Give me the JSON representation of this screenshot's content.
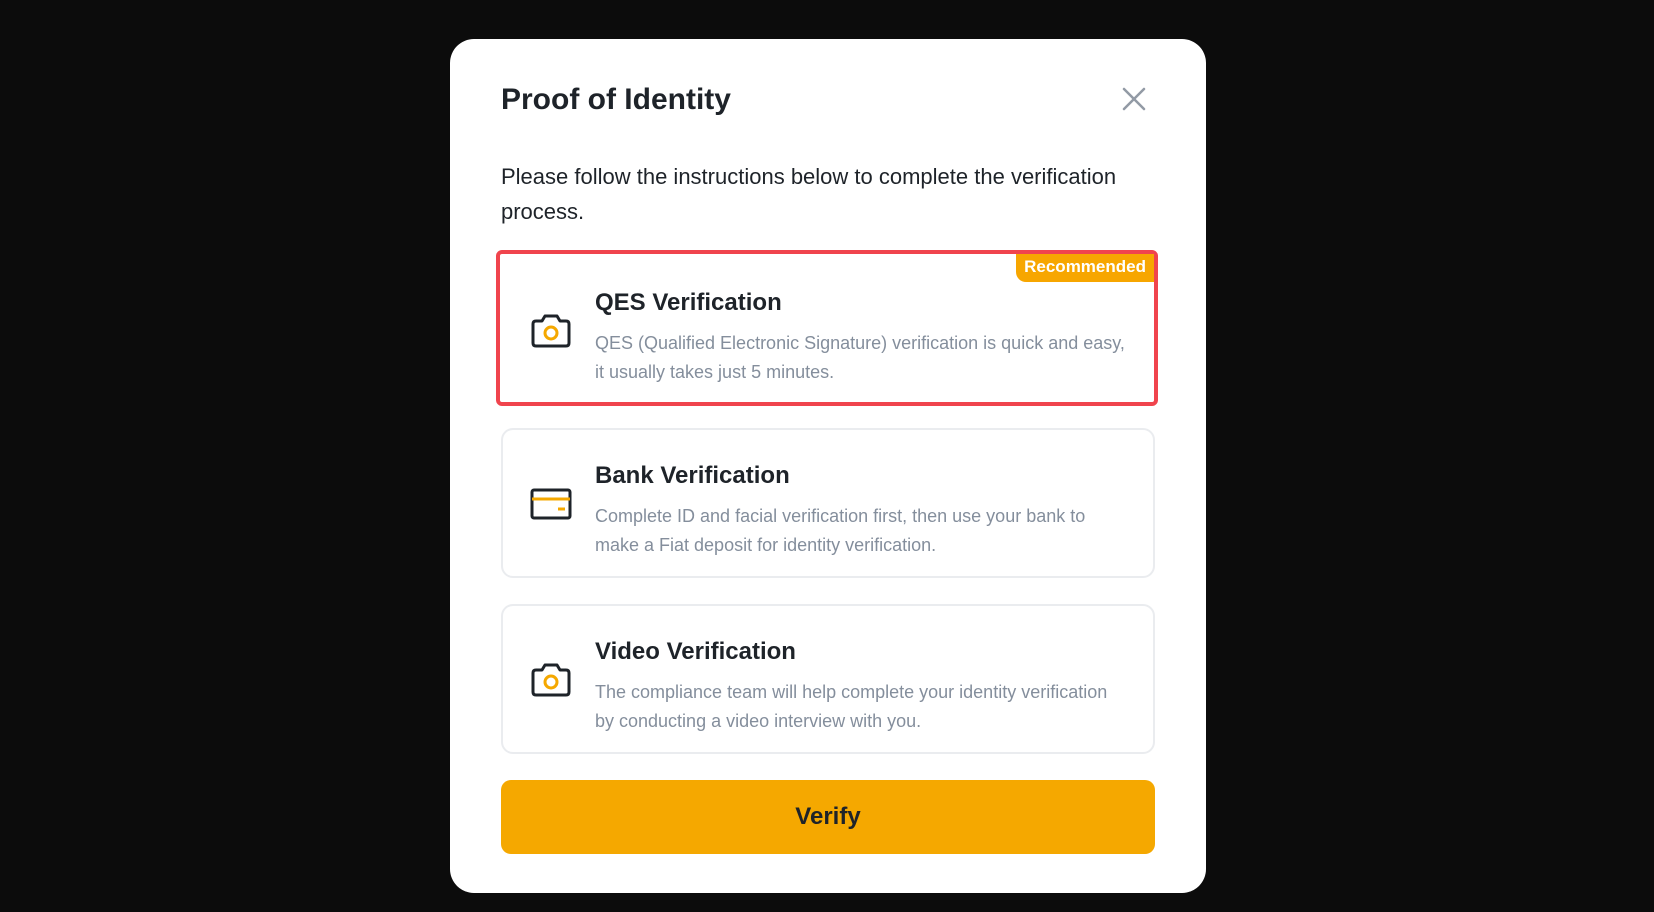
{
  "modal": {
    "title": "Proof of Identity",
    "instructions": "Please follow the instructions below to complete the verification process."
  },
  "options": [
    {
      "title": "QES Verification",
      "description": "QES (Qualified Electronic Signature) verification is quick and easy, it usually takes just 5 minutes.",
      "badge": "Recommended",
      "icon": "camera-icon",
      "selected": true
    },
    {
      "title": "Bank Verification",
      "description": "Complete ID and facial verification first, then use your bank to make a Fiat deposit for identity verification.",
      "icon": "card-icon",
      "selected": false
    },
    {
      "title": "Video Verification",
      "description": "The compliance team will help complete your identity verification by conducting a video interview with you.",
      "icon": "camera-icon",
      "selected": false
    }
  ],
  "actions": {
    "verify_label": "Verify"
  },
  "colors": {
    "accent": "#f5a800",
    "highlight_border": "#f0444d",
    "backdrop": "#0c0c0c"
  }
}
